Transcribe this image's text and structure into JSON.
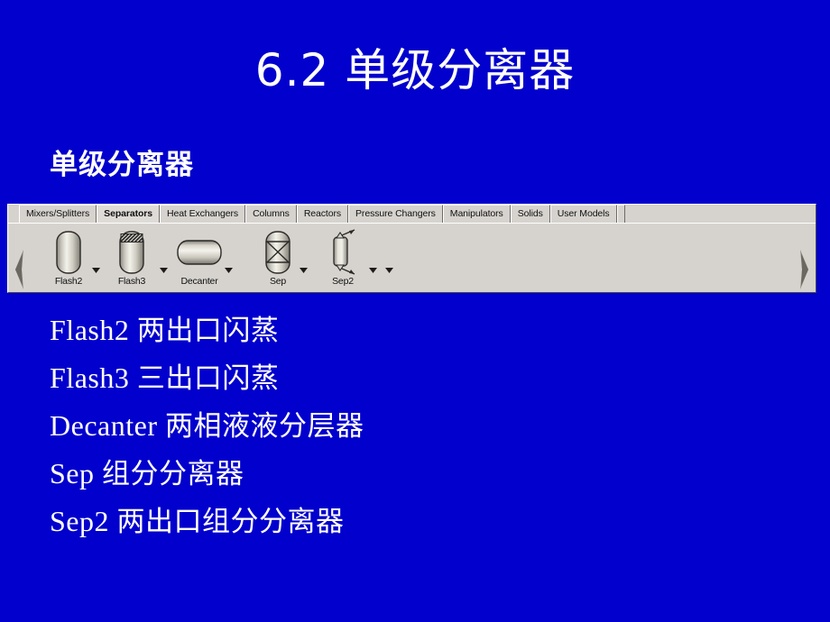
{
  "slide": {
    "background_color": "#0200cc",
    "text_color": "#ffffff",
    "title": "6.2 单级分离器",
    "subtitle": "单级分离器"
  },
  "palette": {
    "name": "Aspen Plus Model Library",
    "background_color": "#d6d3ce",
    "tabs": [
      {
        "label": "Mixers/Splitters",
        "selected": false
      },
      {
        "label": "Separators",
        "selected": true
      },
      {
        "label": "Heat Exchangers",
        "selected": false
      },
      {
        "label": "Columns",
        "selected": false
      },
      {
        "label": "Reactors",
        "selected": false
      },
      {
        "label": "Pressure Changers",
        "selected": false
      },
      {
        "label": "Manipulators",
        "selected": false
      },
      {
        "label": "Solids",
        "selected": false
      },
      {
        "label": "User Models",
        "selected": false
      }
    ],
    "scroll_left": "scroll-left-arrow",
    "scroll_right": "scroll-right-arrow",
    "items": [
      {
        "label": "Flash2",
        "icon": "vertical-vessel-icon"
      },
      {
        "label": "Flash3",
        "icon": "vertical-vessel-hatched-top-icon"
      },
      {
        "label": "Decanter",
        "icon": "horizontal-vessel-icon"
      },
      {
        "label": "Sep",
        "icon": "vertical-vessel-cross-icon"
      },
      {
        "label": "Sep2",
        "icon": "narrow-vessel-arrows-icon"
      }
    ]
  },
  "bullets": [
    {
      "term": "Flash2",
      "desc": "两出口闪蒸"
    },
    {
      "term": "Flash3",
      "desc": "三出口闪蒸"
    },
    {
      "term": "Decanter",
      "desc": "两相液液分层器"
    },
    {
      "term": "Sep",
      "desc": "组分分离器"
    },
    {
      "term": "Sep2",
      "desc": "两出口组分分离器"
    }
  ]
}
